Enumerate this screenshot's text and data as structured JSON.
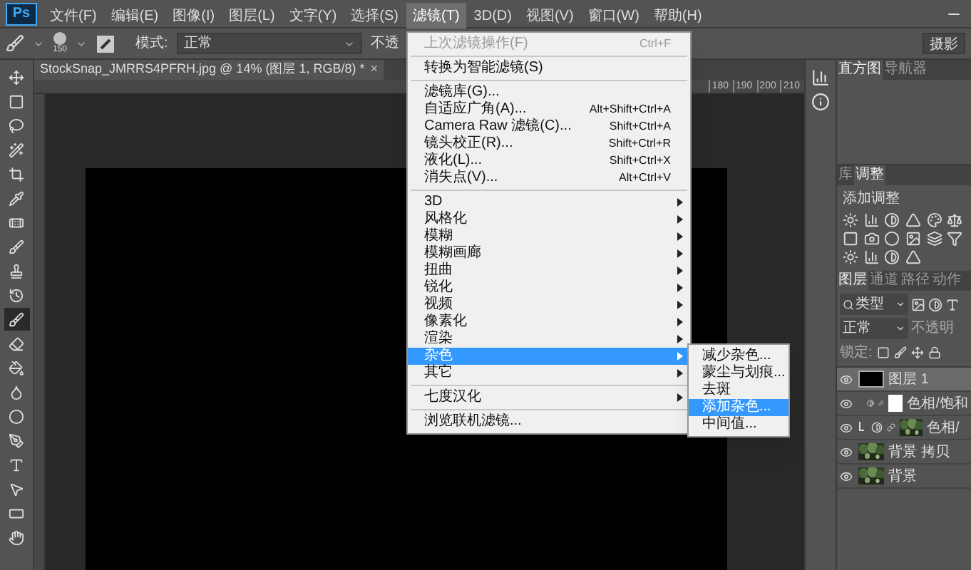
{
  "app_logo": "Ps",
  "menubar": [
    {
      "label": "文件(F)",
      "selected": false
    },
    {
      "label": "编辑(E)",
      "selected": false
    },
    {
      "label": "图像(I)",
      "selected": false
    },
    {
      "label": "图层(L)",
      "selected": false
    },
    {
      "label": "文字(Y)",
      "selected": false
    },
    {
      "label": "选择(S)",
      "selected": false
    },
    {
      "label": "滤镜(T)",
      "selected": true
    },
    {
      "label": "3D(D)",
      "selected": false
    },
    {
      "label": "视图(V)",
      "selected": false
    },
    {
      "label": "窗口(W)",
      "selected": false
    },
    {
      "label": "帮助(H)",
      "selected": false
    }
  ],
  "options_bar": {
    "brush_size": "150",
    "mode_label": "模式:",
    "mode_value": "正常",
    "opacity_label": "不透",
    "workspace": "摄影"
  },
  "open_menu": [
    {
      "kind": "item",
      "label": "上次滤镜操作(F)",
      "shortcut": "Ctrl+F",
      "disabled": true,
      "submenu": false,
      "selected": false
    },
    {
      "kind": "separator"
    },
    {
      "kind": "item",
      "label": "转换为智能滤镜(S)",
      "disabled": false,
      "submenu": false,
      "selected": false
    },
    {
      "kind": "separator"
    },
    {
      "kind": "item",
      "label": "滤镜库(G)...",
      "disabled": false,
      "submenu": false,
      "selected": false
    },
    {
      "kind": "item",
      "label": "自适应广角(A)...",
      "shortcut": "Alt+Shift+Ctrl+A",
      "disabled": false,
      "submenu": false,
      "selected": false
    },
    {
      "kind": "item",
      "label": "Camera Raw 滤镜(C)...",
      "shortcut": "Shift+Ctrl+A",
      "disabled": false,
      "submenu": false,
      "selected": false
    },
    {
      "kind": "item",
      "label": "镜头校正(R)...",
      "shortcut": "Shift+Ctrl+R",
      "disabled": false,
      "submenu": false,
      "selected": false
    },
    {
      "kind": "item",
      "label": "液化(L)...",
      "shortcut": "Shift+Ctrl+X",
      "disabled": false,
      "submenu": false,
      "selected": false
    },
    {
      "kind": "item",
      "label": "消失点(V)...",
      "shortcut": "Alt+Ctrl+V",
      "disabled": false,
      "submenu": false,
      "selected": false
    },
    {
      "kind": "separator"
    },
    {
      "kind": "item",
      "label": "3D",
      "disabled": false,
      "submenu": true,
      "selected": false
    },
    {
      "kind": "item",
      "label": "风格化",
      "disabled": false,
      "submenu": true,
      "selected": false
    },
    {
      "kind": "item",
      "label": "模糊",
      "disabled": false,
      "submenu": true,
      "selected": false
    },
    {
      "kind": "item",
      "label": "模糊画廊",
      "disabled": false,
      "submenu": true,
      "selected": false
    },
    {
      "kind": "item",
      "label": "扭曲",
      "disabled": false,
      "submenu": true,
      "selected": false
    },
    {
      "kind": "item",
      "label": "锐化",
      "disabled": false,
      "submenu": true,
      "selected": false
    },
    {
      "kind": "item",
      "label": "视频",
      "disabled": false,
      "submenu": true,
      "selected": false
    },
    {
      "kind": "item",
      "label": "像素化",
      "disabled": false,
      "submenu": true,
      "selected": false
    },
    {
      "kind": "item",
      "label": "渲染",
      "disabled": false,
      "submenu": true,
      "selected": false
    },
    {
      "kind": "item",
      "label": "杂色",
      "disabled": false,
      "submenu": true,
      "selected": true,
      "children": [
        {
          "label": "减少杂色...",
          "selected": false
        },
        {
          "label": "蒙尘与划痕...",
          "selected": false
        },
        {
          "label": "去斑",
          "selected": false
        },
        {
          "label": "添加杂色...",
          "selected": true
        },
        {
          "label": "中间值...",
          "selected": false
        }
      ]
    },
    {
      "kind": "item",
      "label": "其它",
      "disabled": false,
      "submenu": true,
      "selected": false
    },
    {
      "kind": "separator"
    },
    {
      "kind": "item",
      "label": "七度汉化",
      "disabled": false,
      "submenu": true,
      "selected": false
    },
    {
      "kind": "separator"
    },
    {
      "kind": "item",
      "label": "浏览联机滤镜...",
      "disabled": false,
      "submenu": false,
      "selected": false
    }
  ],
  "tools": [
    {
      "selected": false
    },
    {
      "selected": false
    },
    {
      "selected": false
    },
    {
      "selected": false
    },
    {
      "selected": false
    },
    {
      "selected": false
    },
    {
      "selected": false
    },
    {
      "selected": false
    },
    {
      "selected": false
    },
    {
      "selected": false
    },
    {
      "selected": true
    },
    {
      "selected": false
    },
    {
      "selected": false
    },
    {
      "selected": false
    },
    {
      "selected": false
    },
    {
      "selected": false
    },
    {
      "selected": false
    },
    {
      "selected": false
    },
    {
      "selected": false
    },
    {
      "selected": false
    }
  ],
  "document_tab": {
    "title": "StockSnap_JMRRS4PFRH.jpg @ 14% (图层 1, RGB/8) *",
    "close": "×"
  },
  "ruler": [
    "180",
    "190",
    "200",
    "210"
  ],
  "panels": {
    "top_tabs": [
      {
        "label": "直方图",
        "selected": true
      },
      {
        "label": "导航器",
        "selected": false
      }
    ],
    "adjust_tabs": [
      {
        "label": "库",
        "selected": false
      },
      {
        "label": "调整",
        "selected": true
      }
    ],
    "adjust_title": "添加调整",
    "layer_tabs": [
      {
        "label": "图层",
        "selected": true
      },
      {
        "label": "通道",
        "selected": false
      },
      {
        "label": "路径",
        "selected": false
      },
      {
        "label": "动作",
        "selected": false
      }
    ],
    "filter": "类型",
    "blend": "正常",
    "opacity": "不透明",
    "lock": "锁定:",
    "layers": [
      {
        "name": "图层 1",
        "kind": "solid",
        "visible": true,
        "selected": true
      },
      {
        "name": "色相/饱和",
        "kind": "adjustment",
        "visible": true,
        "selected": false
      },
      {
        "name": "色相/",
        "kind": "clipped",
        "visible": true,
        "selected": false
      },
      {
        "name": "背景 拷贝",
        "visible": true,
        "selected": false
      },
      {
        "name": "背景",
        "visible": true,
        "selected": false
      }
    ]
  }
}
